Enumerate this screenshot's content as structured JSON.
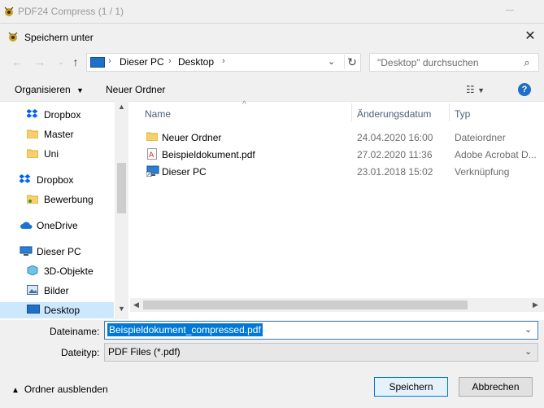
{
  "app": {
    "title": "PDF24 Compress (1 / 1)"
  },
  "dialog": {
    "title": "Speichern unter",
    "address": {
      "segments": [
        "Dieser PC",
        "Desktop"
      ]
    },
    "search": {
      "placeholder": "\"Desktop\" durchsuchen"
    },
    "toolbar": {
      "organize": "Organisieren",
      "new_folder": "Neuer Ordner"
    },
    "nav_tree": [
      {
        "label": "Dropbox",
        "icon": "dropbox-icon",
        "indent": 1
      },
      {
        "label": "Master",
        "icon": "folder-icon",
        "indent": 1
      },
      {
        "label": "Uni",
        "icon": "folder-icon",
        "indent": 1
      },
      {
        "label": "Dropbox",
        "icon": "dropbox-icon",
        "indent": 0
      },
      {
        "label": "Bewerbung",
        "icon": "folder-shared-icon",
        "indent": 1
      },
      {
        "label": "OneDrive",
        "icon": "cloud-icon",
        "indent": 0
      },
      {
        "label": "Dieser PC",
        "icon": "computer-icon",
        "indent": 0
      },
      {
        "label": "3D-Objekte",
        "icon": "cube-icon",
        "indent": 1
      },
      {
        "label": "Bilder",
        "icon": "pictures-icon",
        "indent": 1
      },
      {
        "label": "Desktop",
        "icon": "desktop-icon",
        "indent": 1,
        "selected": true
      }
    ],
    "columns": {
      "name": "Name",
      "date": "Änderungsdatum",
      "type": "Typ"
    },
    "files": [
      {
        "name": "Neuer Ordner",
        "date": "24.04.2020 16:00",
        "type": "Dateiordner",
        "icon": "folder-icon"
      },
      {
        "name": "Beispieldokument.pdf",
        "date": "27.02.2020 11:36",
        "type": "Adobe Acrobat D...",
        "icon": "pdf-icon"
      },
      {
        "name": "Dieser PC",
        "date": "23.01.2018 15:02",
        "type": "Verknüpfung",
        "icon": "computer-shortcut-icon"
      }
    ],
    "form": {
      "filename_label": "Dateiname:",
      "filename_value": "Beispieldokument_compressed.pdf",
      "filetype_label": "Dateityp:",
      "filetype_value": "PDF Files (*.pdf)"
    },
    "footer": {
      "hide_folders": "Ordner ausblenden",
      "save": "Speichern",
      "cancel": "Abbrechen"
    }
  }
}
